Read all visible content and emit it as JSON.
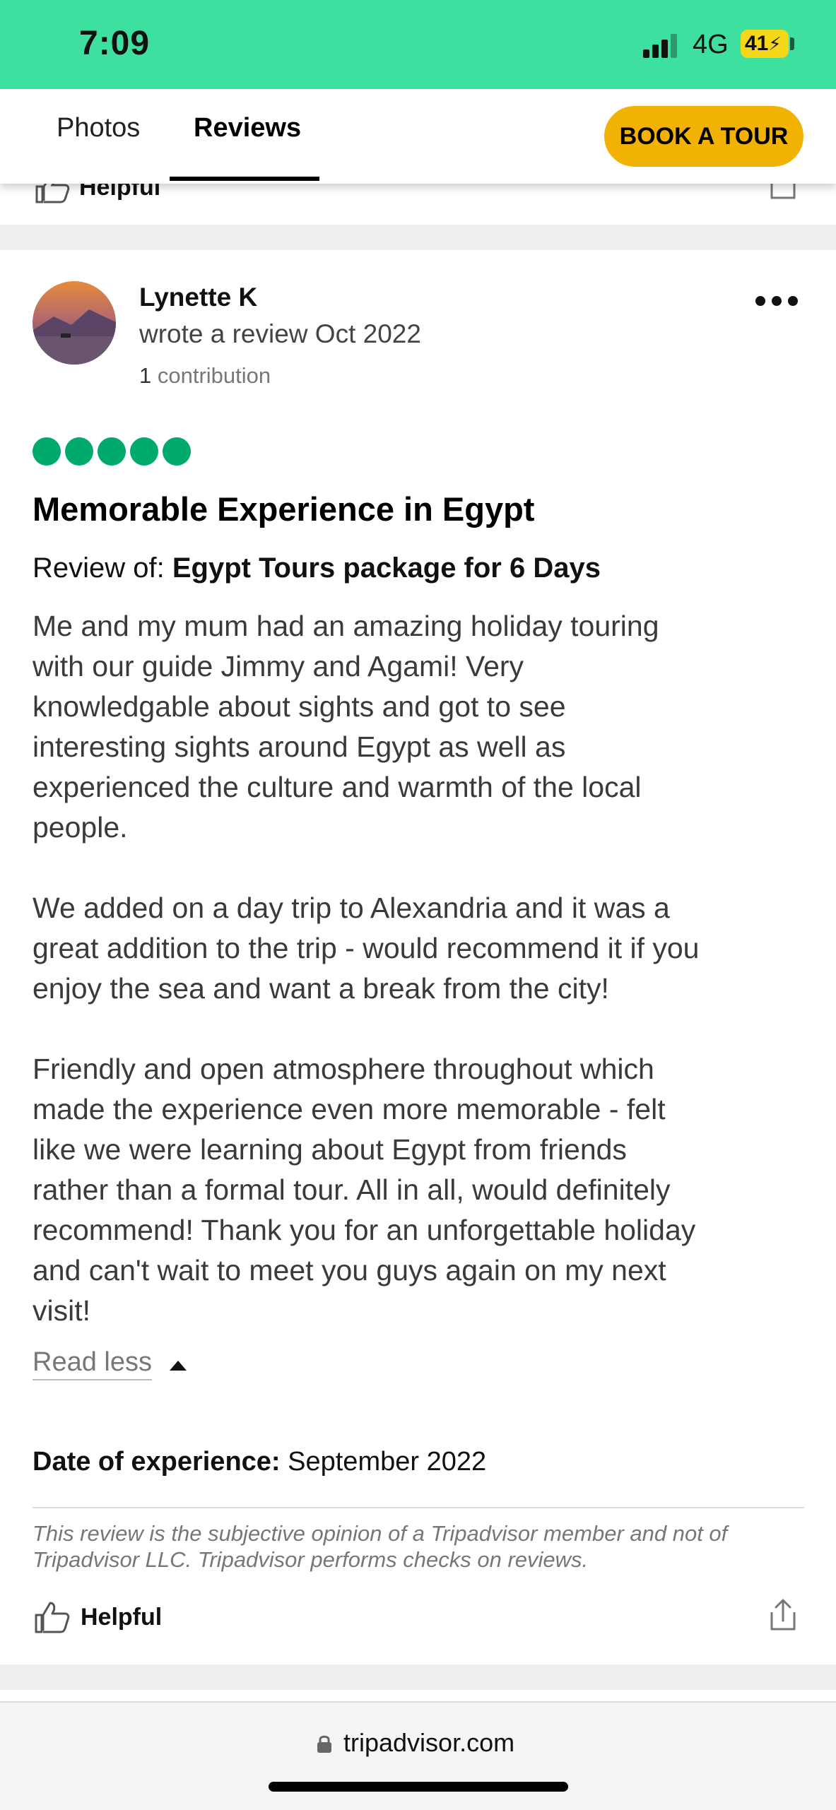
{
  "status_bar": {
    "time": "7:09",
    "network": "4G",
    "battery": "41"
  },
  "nav": {
    "tabs": [
      {
        "label": "Photos"
      },
      {
        "label": "Reviews"
      }
    ],
    "active_tab": "Reviews",
    "book_button": "BOOK A TOUR"
  },
  "previous_review": {
    "helpful_label": "Helpful"
  },
  "review": {
    "author": "Lynette K",
    "meta": "wrote a review Oct 2022",
    "contribution_count": "1",
    "contribution_label": "contribution",
    "rating_bubbles": 5,
    "title": "Memorable Experience in Egypt",
    "review_of_label": "Review of: ",
    "review_of_value": "Egypt Tours package for 6 Days",
    "body_paragraphs": [
      "Me and my mum had an amazing holiday touring\nwith our guide Jimmy and Agami! Very\nknowledgable about sights and got to see\ninteresting sights around Egypt as well as\nexperienced the culture and warmth of the local\npeople.",
      "We added on a day trip to Alexandria and it was a\ngreat addition to the trip - would recommend it if you\nenjoy the sea and want a break from the city!",
      "Friendly and open atmosphere throughout which\nmade the experience even more memorable - felt\nlike we were learning about Egypt from friends\nrather than a formal tour. All in all, would definitely\nrecommend! Thank you for an unforgettable holiday\nand can't wait to meet you guys again on my next\nvisit!"
    ],
    "read_less": "Read less",
    "date_of_experience_label": "Date of experience:",
    "date_of_experience_value": " September 2022",
    "disclaimer": "This review is the subjective opinion of a Tripadvisor member and not of Tripadvisor LLC. Tripadvisor performs checks on reviews.",
    "helpful_label": "Helpful"
  },
  "browser": {
    "url": "tripadvisor.com"
  },
  "colors": {
    "status_bar": "#3ee0a0",
    "button": "#f2b203",
    "bubble": "#00aa6c"
  }
}
